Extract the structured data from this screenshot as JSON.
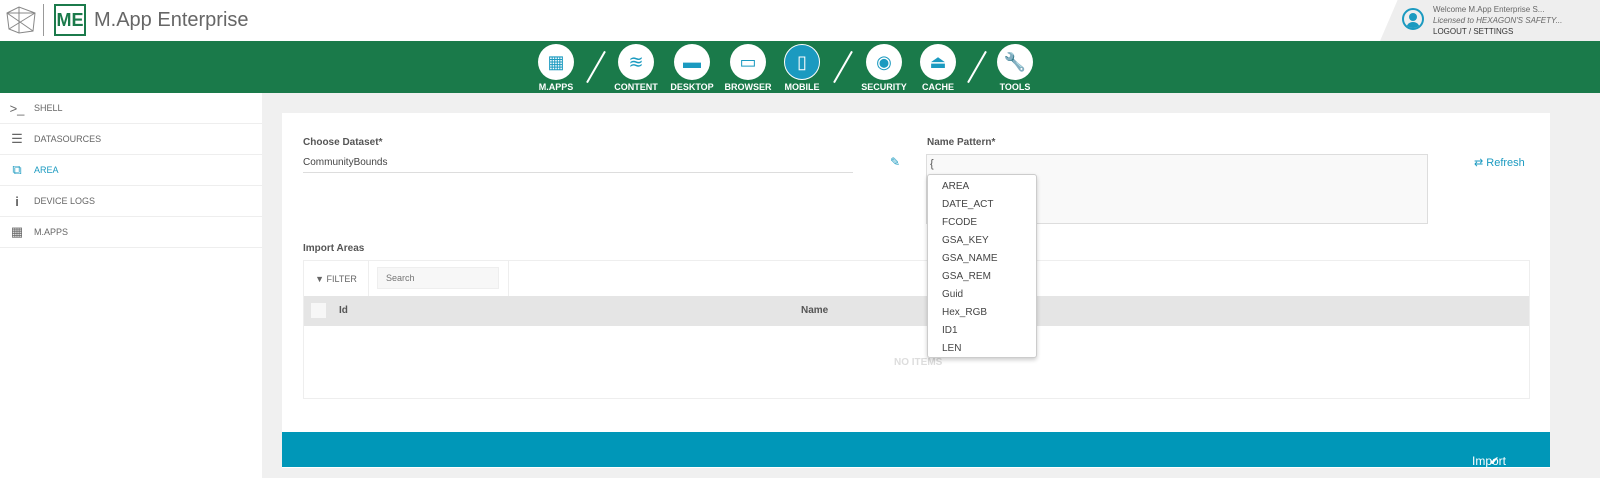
{
  "header": {
    "logo_text": "ME",
    "app_title": "M.App Enterprise",
    "welcome": "Welcome  M.App Enterprise S...",
    "licensed": "Licensed to HEXAGON'S SAFETY...",
    "logout": "LOGOUT",
    "settings": "SETTINGS",
    "separator": "/"
  },
  "nav": [
    {
      "label": "M.APPS",
      "icon": "grid-icon"
    },
    {
      "label": "CONTENT",
      "icon": "content-icon"
    },
    {
      "label": "DESKTOP",
      "icon": "monitor-icon"
    },
    {
      "label": "BROWSER",
      "icon": "browser-icon"
    },
    {
      "label": "MOBILE",
      "icon": "mobile-icon",
      "active": true
    },
    {
      "label": "SECURITY",
      "icon": "user-icon"
    },
    {
      "label": "CACHE",
      "icon": "inbox-icon"
    },
    {
      "label": "TOOLS",
      "icon": "wrench-icon"
    }
  ],
  "sidebar": [
    {
      "label": "SHELL",
      "icon": "terminal-icon"
    },
    {
      "label": "DATASOURCES",
      "icon": "database-icon"
    },
    {
      "label": "AREA",
      "icon": "area-icon",
      "active": true
    },
    {
      "label": "DEVICE LOGS",
      "icon": "info-icon"
    },
    {
      "label": "M.APPS",
      "icon": "grid-icon"
    }
  ],
  "form": {
    "dataset_label": "Choose Dataset*",
    "dataset_value": "CommunityBounds",
    "pattern_label": "Name Pattern*",
    "pattern_value": "{",
    "refresh": "Refresh"
  },
  "autocomplete": [
    "AREA",
    "DATE_ACT",
    "FCODE",
    "GSA_KEY",
    "GSA_NAME",
    "GSA_REM",
    "Guid",
    "Hex_RGB",
    "ID1",
    "LEN"
  ],
  "grid": {
    "title": "Import Areas",
    "filter": "FILTER",
    "search_placeholder": "Search",
    "columns": [
      "Id",
      "Name"
    ],
    "empty": "NO ITEMS"
  },
  "import_label": "Import",
  "colors": {
    "brand_green": "#1a7a4a",
    "accent": "#1b9ac0",
    "import_bar": "#0097b8"
  }
}
